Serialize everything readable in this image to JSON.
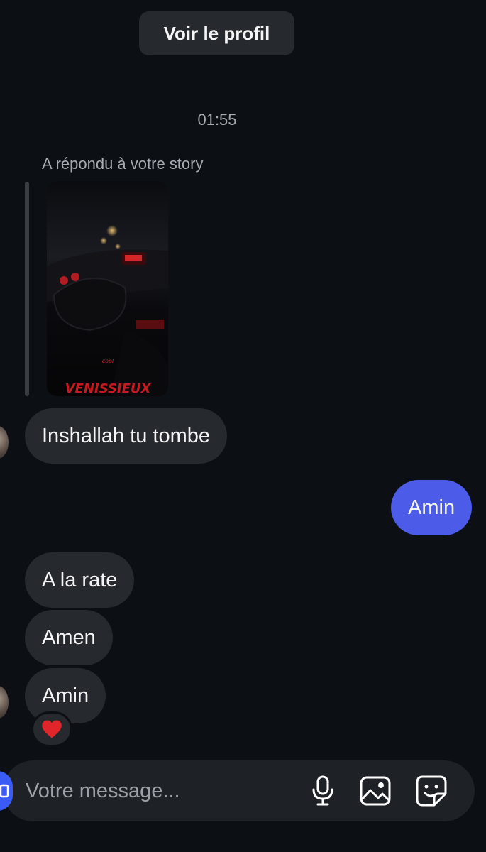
{
  "header": {
    "view_profile_label": "Voir le profil"
  },
  "thread": {
    "timestamp": "01:55",
    "reply_context_label": "A répondu à votre story",
    "story_overlay_text": "VENISSIEUX",
    "messages": [
      {
        "side": "incoming",
        "text": "Inshallah tu tombe"
      },
      {
        "side": "outgoing",
        "text": "Amin"
      },
      {
        "side": "incoming",
        "text": "A la rate"
      },
      {
        "side": "incoming",
        "text": "Amen"
      },
      {
        "side": "incoming",
        "text": "Amin"
      }
    ],
    "reaction": {
      "emoji": "heart",
      "color": "#e0262b"
    }
  },
  "composer": {
    "placeholder": "Votre message...",
    "icons": [
      "camera-icon",
      "microphone-icon",
      "gallery-icon",
      "sticker-icon"
    ]
  },
  "colors": {
    "background": "#0c1014",
    "incoming_bubble": "#26292e",
    "outgoing_bubble": "#4c5ce8",
    "accent": "#3b5bf6"
  }
}
